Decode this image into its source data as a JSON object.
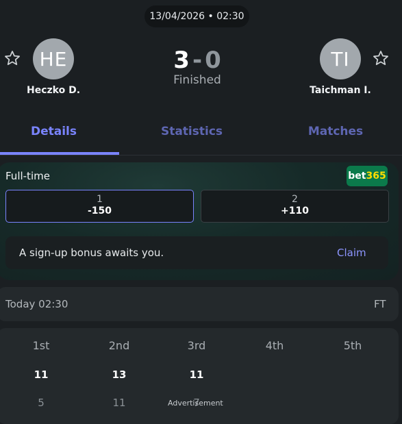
{
  "header": {
    "datetime": "13/04/2026 • 02:30"
  },
  "match": {
    "home": {
      "initials": "HE",
      "name": "Heczko D."
    },
    "away": {
      "initials": "TI",
      "name": "Taichman I."
    },
    "score_home": "3",
    "score_sep": "-",
    "score_away": "0",
    "status": "Finished"
  },
  "tabs": [
    {
      "label": "Details"
    },
    {
      "label": "Statistics"
    },
    {
      "label": "Matches"
    }
  ],
  "odds": {
    "title": "Full-time",
    "bookmaker_b": "bet",
    "bookmaker_n": "365",
    "options": [
      {
        "label": "1",
        "value": "-150"
      },
      {
        "label": "2",
        "value": "+110"
      }
    ],
    "promo_text": "A sign-up bonus awaits you.",
    "promo_cta": "Claim"
  },
  "timeinfo": {
    "left": "Today 02:30",
    "right": "FT"
  },
  "sets": {
    "headers": [
      "1st",
      "2nd",
      "3rd",
      "4th",
      "5th"
    ],
    "row1": [
      "11",
      "13",
      "11"
    ],
    "row2": [
      "5",
      "11",
      "7"
    ]
  },
  "ad_label": "Advertisement",
  "colors": {
    "accent": "#7a84ff",
    "background": "#1b1f22",
    "bet365_green": "#0b7a4b",
    "bet365_yellow": "#ffdd00"
  },
  "icons": [
    "star-icon"
  ]
}
